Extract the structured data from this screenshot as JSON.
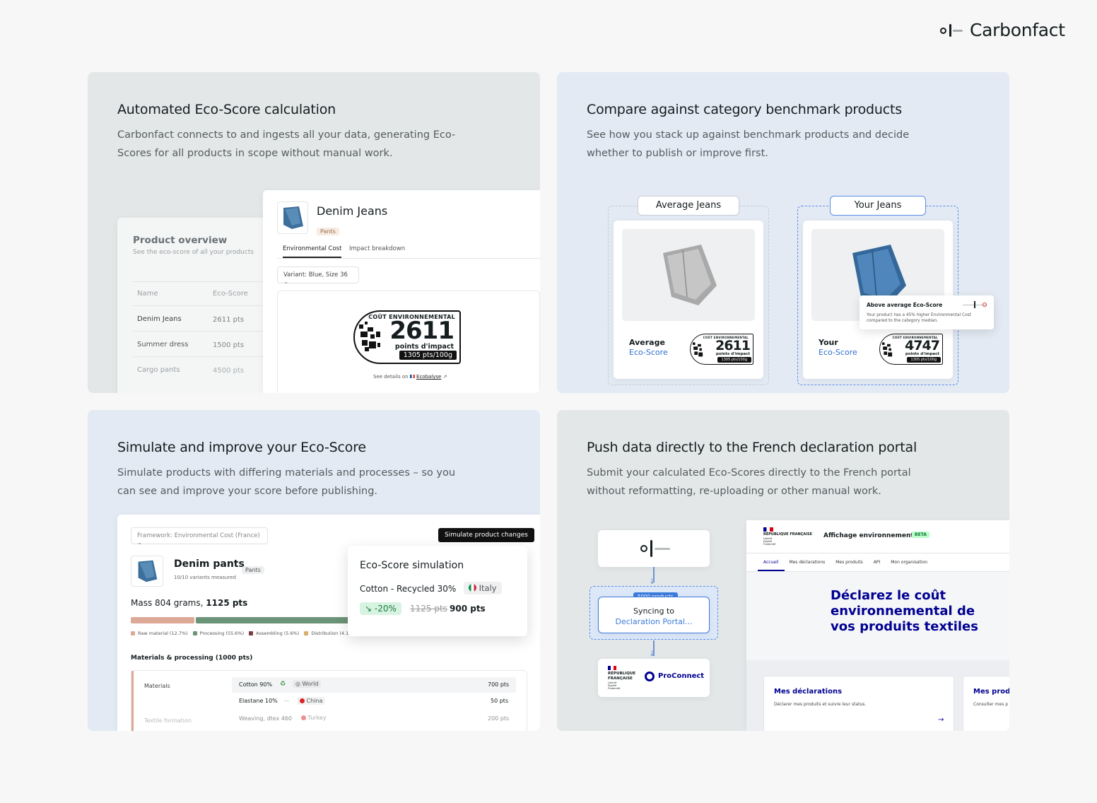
{
  "brand": {
    "name": "Carbonfact"
  },
  "q1": {
    "title": "Automated Eco-Score calculation",
    "desc": "Carbonfact connects to and ingests all your data, generating Eco-Scores for all products in scope without manual work.",
    "overview": {
      "title": "Product overview",
      "subtitle": "See the eco-score of all your products",
      "col_name": "Name",
      "col_score": "Eco-Score",
      "rows": [
        {
          "name": "Denim Jeans",
          "score": "2611 pts"
        },
        {
          "name": "Summer dress",
          "score": "1500 pts"
        },
        {
          "name": "Cargo pants",
          "score": "4500 pts"
        }
      ]
    },
    "product": {
      "name": "Denim Jeans",
      "tag": "Pants",
      "tab_active": "Environmental Cost",
      "tab_other": "Impact breakdown",
      "variant": "Variant: Blue, Size 36",
      "label_head": "COÛT ENVIRONNEMENTAL",
      "label_value": "2611",
      "label_unit": "points d'impact",
      "label_per": "1305 pts/100g",
      "see_details": "See details on",
      "ecobalyse": "Ecobalyse"
    }
  },
  "q2": {
    "title": "Compare against category benchmark products",
    "desc": "See how you stack up against benchmark products and decide whether to publish or improve first.",
    "avg": {
      "label": "Average Jeans",
      "eco_line1": "Average",
      "eco_line2": "Eco-Score",
      "value": "2611",
      "head": "COÛT ENVIRONNEMENTAL",
      "unit": "points d'impact",
      "per": "1305 pts/100g"
    },
    "your": {
      "label": "Your Jeans",
      "eco_line1": "Your",
      "eco_line2": "Eco-Score",
      "value": "4747",
      "head": "COÛT ENVIRONNEMENTAL",
      "unit": "points d'impact",
      "per": "1305 pts/100g"
    },
    "tooltip": {
      "title": "Above average Eco-Score",
      "body": "Your product has a 45% higher Environmental Cost compared to the category median."
    }
  },
  "q3": {
    "title": "Simulate and improve your Eco-Score",
    "desc": "Simulate products with differing materials and processes – so you can see and improve your score before publishing.",
    "framework": "Framework: Environmental Cost (France)",
    "simulate_btn": "Simulate product changes",
    "product": "Denim pants",
    "tag": "Pants",
    "variants": "10/10 variants measured",
    "mass_label": "Mass",
    "mass_value": "804 grams,",
    "mass_pts": "1125 pts",
    "breakdown": [
      {
        "label": "Raw material (12.7%)",
        "pct": 12.7,
        "color": "#dca996"
      },
      {
        "label": "Processing (55.6%)",
        "pct": 55.6,
        "color": "#6c9478"
      },
      {
        "label": "Assembling (5.6%)",
        "pct": 5.6,
        "color": "#7e3a44"
      },
      {
        "label": "Distribution (4.1%)",
        "pct": 4.1,
        "color": "#d8b06a"
      }
    ],
    "materials_heading": "Materials & processing (1000 pts)",
    "rows": [
      {
        "group": "Materials",
        "item": "Cotton 90%",
        "origin": "World",
        "pts": "700 pts"
      },
      {
        "group": "",
        "item": "Elastane 10%",
        "origin": "China",
        "pts": "50 pts"
      },
      {
        "group": "Textile formation",
        "item": "Weaving, dtex 460",
        "origin": "Turkey",
        "pts": "200 pts"
      }
    ],
    "sim": {
      "title": "Eco-Score simulation",
      "item": "Cotton - Recycled 30%",
      "origin": "Italy",
      "delta": "-20%",
      "old": "1125 pts",
      "new": "900 pts"
    }
  },
  "q4": {
    "title": "Push data directly to the French declaration portal",
    "desc": "Submit your calculated Eco-Scores directly to the French portal without reformatting, re-uploading or other manual work.",
    "badge": "5000 products",
    "sync_line1": "Syncing to",
    "sync_line2": "Declaration Portal...",
    "rf": "RÉPUBLIQUE FRANÇAISE",
    "rf_motto": "Liberté Égalité Fraternité",
    "proconnect": "ProConnect",
    "portal_title": "Affichage environnemental",
    "beta": "BETA",
    "nav": [
      "Accueil",
      "Mes déclarations",
      "Mes produits",
      "API",
      "Mon organisation"
    ],
    "hero": "Déclarez le coût environnemental de vos produits textiles",
    "card1_title": "Mes déclarations",
    "card1_body": "Déclarer mes produits et suivre leur status.",
    "card2_title": "Mes produ",
    "card2_body": "Consulter mes p"
  }
}
